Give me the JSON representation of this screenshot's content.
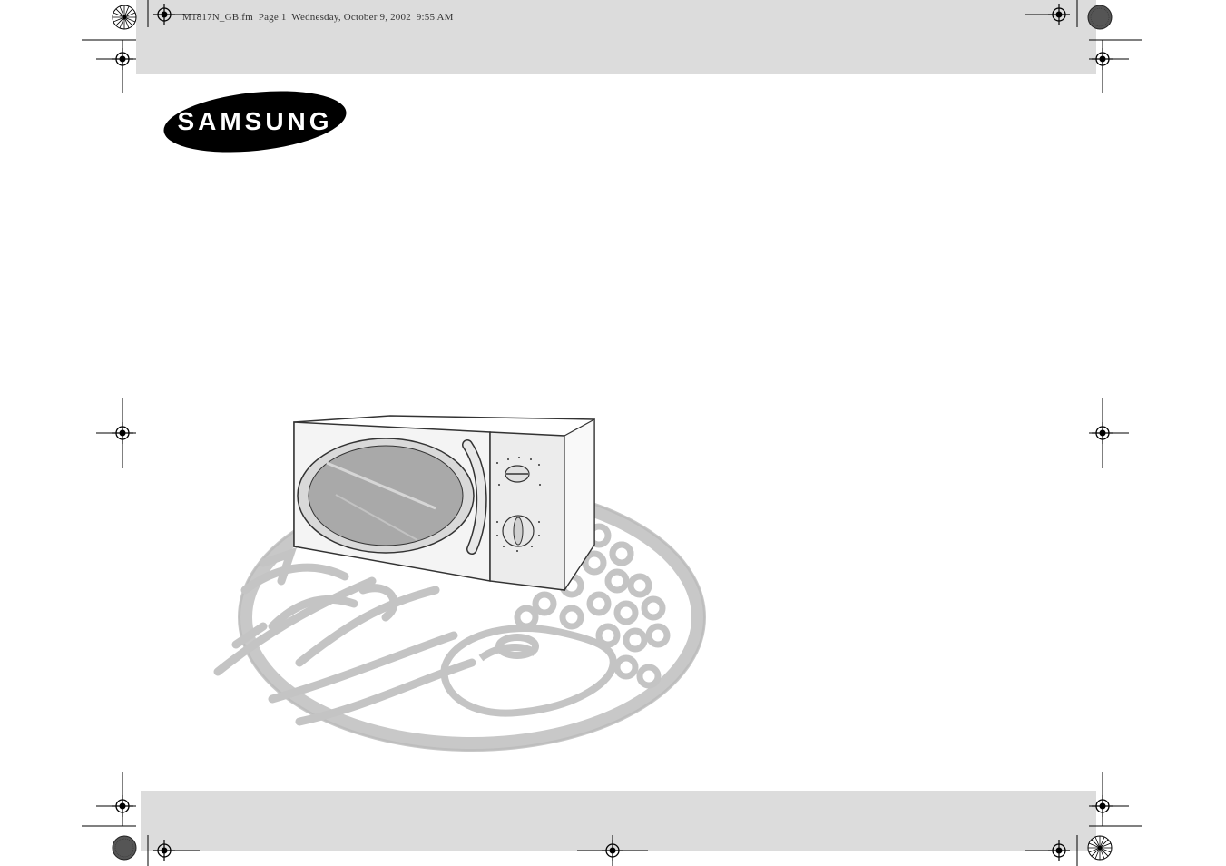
{
  "header": {
    "file_info": "M1817N_GB.fm  Page 1  Wednesday, October 9, 2002  9:55 AM"
  },
  "brand": {
    "logo_text": "SAMSUNG"
  },
  "colors": {
    "band": "#dcdcdc",
    "logo": "#000000",
    "plate": "#c8c8c8"
  },
  "icons": [
    "registration-mark-icon",
    "color-bar-icon",
    "crop-mark-icon"
  ]
}
